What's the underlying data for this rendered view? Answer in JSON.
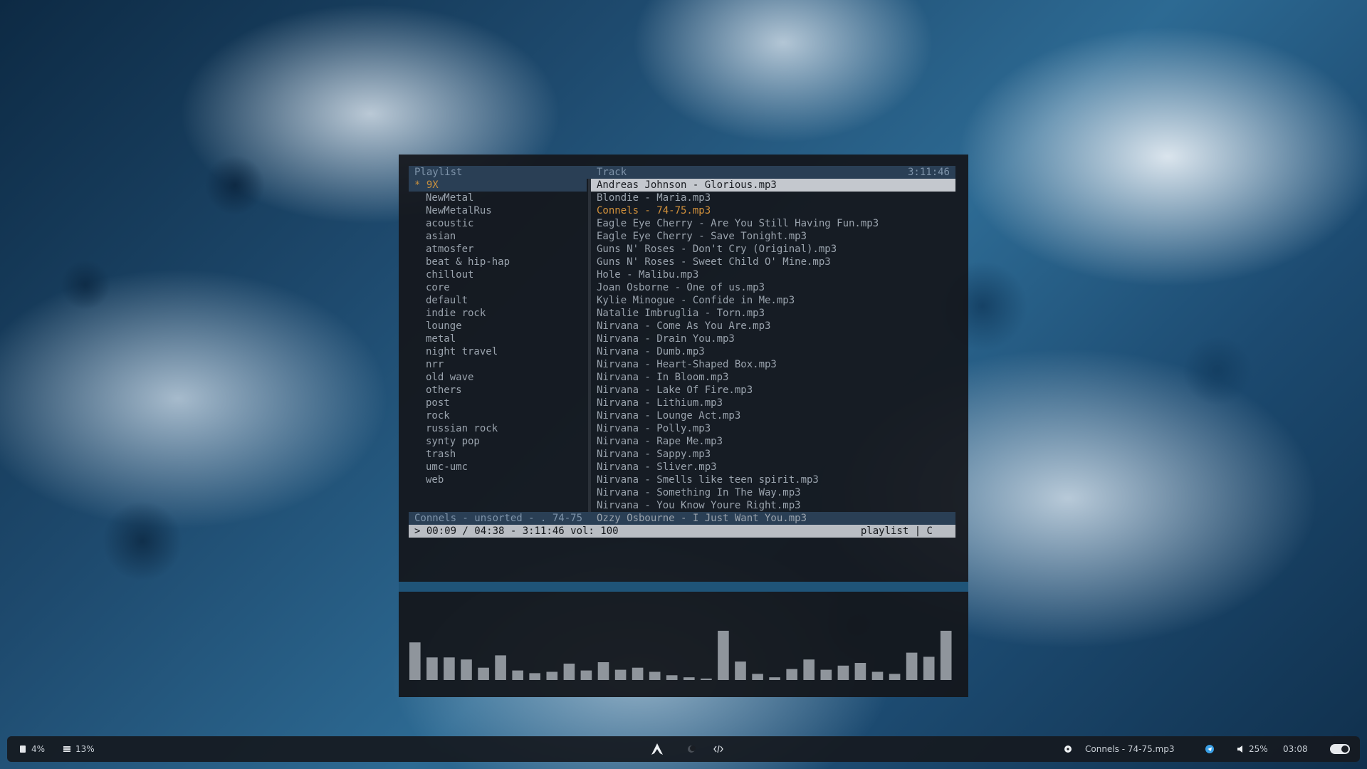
{
  "player": {
    "header": {
      "playlist_label": "Playlist",
      "track_label": "Track",
      "total_time": "3:11:46"
    },
    "playlists": [
      "* 9X",
      "NewMetal",
      "NewMetalRus",
      "acoustic",
      "asian",
      "atmosfer",
      "beat & hip-hap",
      "chillout",
      "core",
      "default",
      "indie rock",
      "lounge",
      "metal",
      "night travel",
      "nrr",
      "old wave",
      "others",
      "post",
      "rock",
      "russian rock",
      "synty pop",
      "trash",
      "umc-umc",
      "web"
    ],
    "tracks": [
      "Andreas Johnson - Glorious.mp3",
      "Blondie - Maria.mp3",
      "Connels - 74-75.mp3",
      "Eagle Eye Cherry - Are You Still Having Fun.mp3",
      "Eagle Eye Cherry - Save Tonight.mp3",
      "Guns N' Roses - Don't Cry (Original).mp3",
      "Guns N' Roses - Sweet Child O' Mine.mp3",
      "Hole - Malibu.mp3",
      "Joan Osborne - One of us.mp3",
      "Kylie Minogue - Confide in Me.mp3",
      "Natalie Imbruglia - Torn.mp3",
      "Nirvana - Come As You Are.mp3",
      "Nirvana - Drain You.mp3",
      "Nirvana - Dumb.mp3",
      "Nirvana - Heart-Shaped Box.mp3",
      "Nirvana - In Bloom.mp3",
      "Nirvana - Lake Of Fire.mp3",
      "Nirvana - Lithium.mp3",
      "Nirvana - Lounge Act.mp3",
      "Nirvana - Polly.mp3",
      "Nirvana - Rape Me.mp3",
      "Nirvana - Sappy.mp3",
      "Nirvana - Sliver.mp3",
      "Nirvana - Smells like teen spirit.mp3",
      "Nirvana - Something In The Way.mp3",
      "Nirvana - You Know Youre Right.mp3",
      "Ozzy Osbourne - I Just Want You.mp3"
    ],
    "selected_track_index": 0,
    "playing_track_index": 2,
    "status_line": "Connels - unsorted - . 74-75",
    "command_line": {
      "left": "> 00:09 / 04:38 - 3:11:46 vol: 100",
      "right": "playlist | C"
    }
  },
  "visualizer": {
    "bar_levels": [
      0.55,
      0.33,
      0.33,
      0.3,
      0.18,
      0.36,
      0.14,
      0.1,
      0.12,
      0.24,
      0.14,
      0.26,
      0.15,
      0.18,
      0.12,
      0.07,
      0.04,
      0.02,
      0.72,
      0.27,
      0.09,
      0.04,
      0.16,
      0.3,
      0.15,
      0.21,
      0.25,
      0.12,
      0.09,
      0.4,
      0.34,
      0.72
    ],
    "bar_color": "#8f959c"
  },
  "taskbar": {
    "cpu": "4%",
    "memory": "13%",
    "now_playing": "Connels - 74-75.mp3",
    "volume": "25%",
    "clock": "03:08",
    "toggle_on": true
  },
  "colors": {
    "accent_bar": "#2a3f55",
    "playing": "#d2913b",
    "selection": "#c4c8ce",
    "telegram": "#3aa0e6"
  }
}
